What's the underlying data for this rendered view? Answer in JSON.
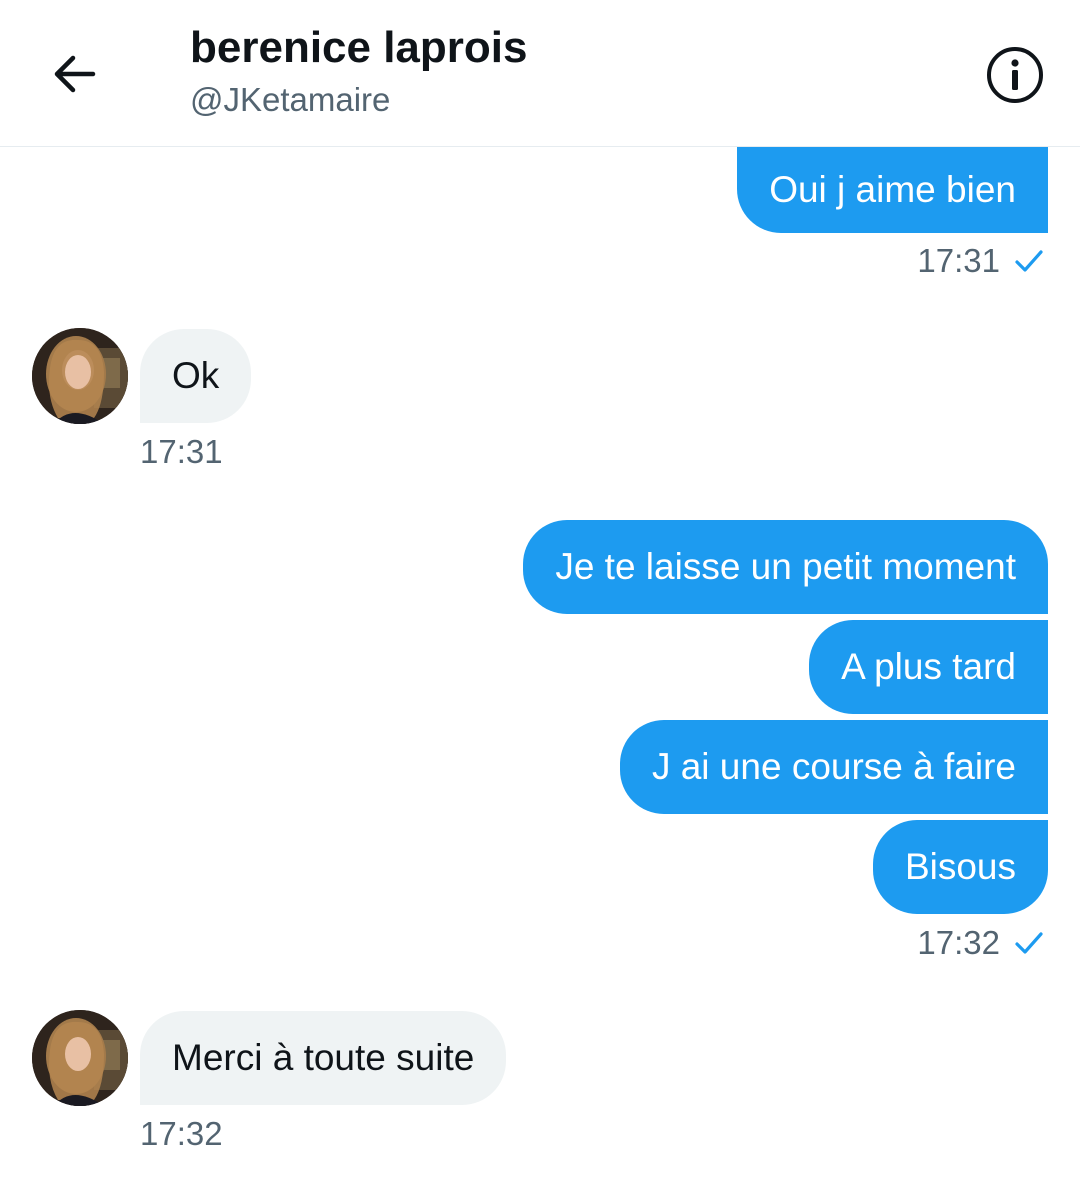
{
  "header": {
    "name": "berenice laprois",
    "handle": "@JKetamaire"
  },
  "messages": [
    {
      "direction": "out",
      "text": "Oui j aime bien"
    },
    {
      "direction": "out",
      "timestamp": "17:31"
    },
    {
      "direction": "in",
      "text": "Ok"
    },
    {
      "direction": "in",
      "timestamp": "17:31"
    },
    {
      "direction": "out",
      "text": "Je te laisse un petit moment"
    },
    {
      "direction": "out",
      "text": "A plus tard"
    },
    {
      "direction": "out",
      "text": "J ai une course à faire"
    },
    {
      "direction": "out",
      "text": "Bisous"
    },
    {
      "direction": "out",
      "timestamp": "17:32"
    },
    {
      "direction": "in",
      "text": "Merci à toute suite"
    },
    {
      "direction": "in",
      "timestamp": "17:32"
    }
  ],
  "icons": {
    "back": "arrow-left-icon",
    "info": "info-icon",
    "sent": "check-icon"
  },
  "colors": {
    "outgoing_bubble": "#1d9bf0",
    "incoming_bubble": "#eff3f4",
    "secondary_text": "#536471"
  }
}
